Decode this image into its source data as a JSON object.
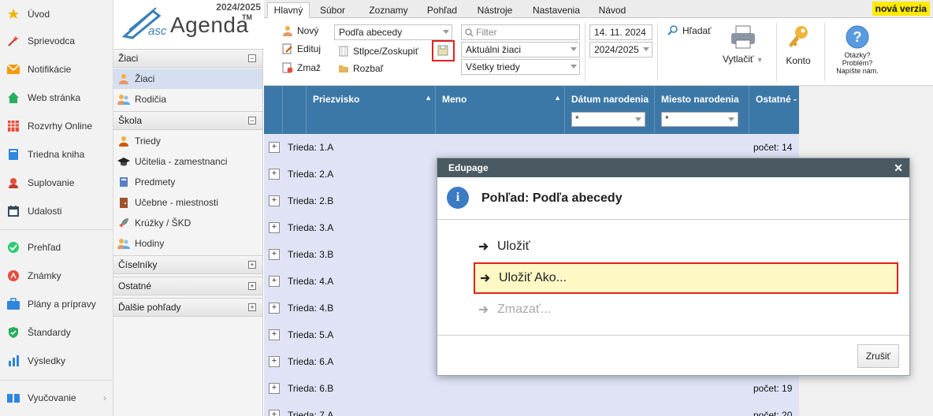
{
  "leftnav": {
    "items": [
      {
        "label": "Úvod",
        "icon": "star-icon"
      },
      {
        "label": "Sprievodca",
        "icon": "wizard-icon"
      },
      {
        "label": "Notifikácie",
        "icon": "envelope-icon"
      },
      {
        "label": "Web stránka",
        "icon": "home-icon"
      },
      {
        "label": "Rozvrhy Online",
        "icon": "timetable-icon"
      },
      {
        "label": "Triedna kniha",
        "icon": "book-icon"
      },
      {
        "label": "Suplovanie",
        "icon": "substitute-icon"
      },
      {
        "label": "Udalosti",
        "icon": "calendar-icon"
      },
      {
        "label": "Prehľad",
        "icon": "check-circle-icon"
      },
      {
        "label": "Známky",
        "icon": "grades-icon"
      },
      {
        "label": "Plány a prípravy",
        "icon": "briefcase-icon"
      },
      {
        "label": "Štandardy",
        "icon": "shield-check-icon"
      },
      {
        "label": "Výsledky",
        "icon": "bar-chart-icon"
      },
      {
        "label": "Vyučovanie",
        "icon": "open-book-icon"
      }
    ]
  },
  "logo": {
    "year": "2024/2025",
    "asc": "asc",
    "agenda": "Agenda",
    "tm": "TM"
  },
  "sidebar": {
    "sections": [
      {
        "label": "Žiaci",
        "toggle": "−"
      },
      {
        "label": "Škola",
        "toggle": "−"
      },
      {
        "label": "Číselníky",
        "toggle": "+"
      },
      {
        "label": "Ostatné",
        "toggle": "+"
      },
      {
        "label": "Ďalšie pohľady",
        "toggle": "+"
      }
    ],
    "ziaci_items": [
      {
        "label": "Žiaci"
      },
      {
        "label": "Rodičia"
      }
    ],
    "skola_items": [
      {
        "label": "Triedy"
      },
      {
        "label": "Učitelia - zamestnanci"
      },
      {
        "label": "Predmety"
      },
      {
        "label": "Učebne - miestnosti"
      },
      {
        "label": "Krúžky / ŠKD"
      },
      {
        "label": "Hodiny"
      }
    ]
  },
  "tabs": [
    "Hlavný",
    "Súbor",
    "Zoznamy",
    "Pohľad",
    "Nástroje",
    "Nastavenia",
    "Návod"
  ],
  "new_version": "nová verzia",
  "ribbon": {
    "novy": "Nový",
    "edituj": "Edituj",
    "zmaz": "Zmaž",
    "view_select": "Podľa abecedy",
    "stlpce": "Stlpce/Zoskupiť",
    "rozbal": "Rozbaľ",
    "filter_placeholder": "Filter",
    "students_select": "Aktuálni žiaci",
    "classes_select": "Všetky triedy",
    "date": "14. 11. 2024",
    "year_select": "2024/2025",
    "hladat": "Hľadať",
    "vytlacit": "Vytlačiť",
    "konto": "Konto",
    "help_1": "Otázky?",
    "help_2": "Problém?",
    "help_3": "Napíšte nám."
  },
  "grid": {
    "columns": [
      "Priezvisko",
      "Meno",
      "Dátum narodenia",
      "Miesto narodenia",
      "Ostatné -"
    ],
    "filter_value": "*",
    "rows": [
      {
        "label": "Trieda: 1.A",
        "count": "počet: 14"
      },
      {
        "label": "Trieda: 2.A",
        "count": ""
      },
      {
        "label": "Trieda: 2.B",
        "count": ""
      },
      {
        "label": "Trieda: 3.A",
        "count": ""
      },
      {
        "label": "Trieda: 3.B",
        "count": ""
      },
      {
        "label": "Trieda: 4.A",
        "count": ""
      },
      {
        "label": "Trieda: 4.B",
        "count": ""
      },
      {
        "label": "Trieda: 5.A",
        "count": ""
      },
      {
        "label": "Trieda: 6.A",
        "count": ""
      },
      {
        "label": "Trieda: 6.B",
        "count": "počet: 19"
      },
      {
        "label": "Trieda: 7.A",
        "count": "počet: 20"
      }
    ]
  },
  "dialog": {
    "title": "Edupage",
    "header": "Pohľad: Podľa abecedy",
    "options": [
      "Uložiť",
      "Uložiť Ako...",
      "Zmazať..."
    ],
    "cancel": "Zrušiť"
  },
  "colors": {
    "grid_header": "#3c78a7",
    "grid_body": "#dfe3f5",
    "dialog_title": "#4a5a63",
    "highlight": "#fdf8c4",
    "annotation_red": "#e0231c"
  }
}
